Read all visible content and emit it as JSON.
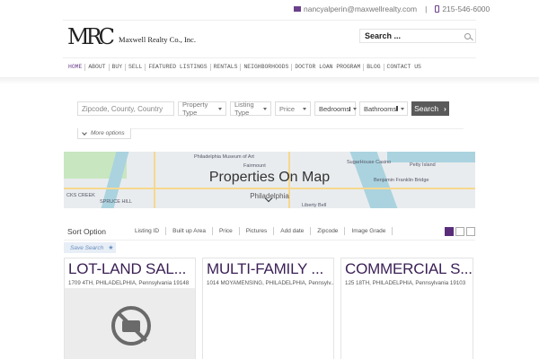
{
  "topbar": {
    "email": "nancyalperin@maxwellrealty.com",
    "separator": "|",
    "phone": "215-546-6000"
  },
  "logo": {
    "mark": "MRC",
    "name": "Maxwell Realty Co., Inc."
  },
  "search": {
    "placeholder": "Search ..."
  },
  "nav": [
    "HOME",
    "ABOUT",
    "BUY",
    "SELL",
    "FEATURED LISTINGS",
    "RENTALS",
    "NEIGHBORHOODS",
    "DOCTOR LOAN PROGRAM",
    "BLOG",
    "CONTACT US"
  ],
  "filters": {
    "zip_placeholder": "Zipcode, County, Country",
    "property_type": "Property Type",
    "listing_type": "Listing Type",
    "price": "Price",
    "bedrooms": "Bedrooms",
    "bathrooms": "Bathrooms",
    "search_button": "Search",
    "more_options": "More options"
  },
  "map": {
    "title": "Properties On Map",
    "labels": [
      "Philadelphia Museum of Art",
      "Fairmount",
      "SugarHouse Casino",
      "Petty Island",
      "Benjamin Franklin Bridge",
      "SPRUCE HILL",
      "Philadelphia",
      "Liberty Bell",
      "CKS CREEK"
    ]
  },
  "sort": {
    "label": "Sort Option",
    "options": [
      "Listing ID",
      "Built up Area",
      "Price",
      "Pictures",
      "Add date",
      "Zipcode",
      "Image Grade"
    ]
  },
  "save_search": "Save Search",
  "listings": [
    {
      "title": "LOT-LAND SAL...",
      "address": "1709 4TH, PHILADELPHIA, Pennsylvania 19148"
    },
    {
      "title": "MULTI-FAMILY ...",
      "address": "1014 MOYAMENSING, PHILADELPHIA, Pennsylv..."
    },
    {
      "title": "COMMERCIAL S...",
      "address": "125 18TH, PHILADELPHIA, Pennsylvania 19103"
    }
  ],
  "colors": {
    "accent": "#5a2d7a",
    "title": "#3a1f55",
    "button": "#5a5a5a"
  }
}
